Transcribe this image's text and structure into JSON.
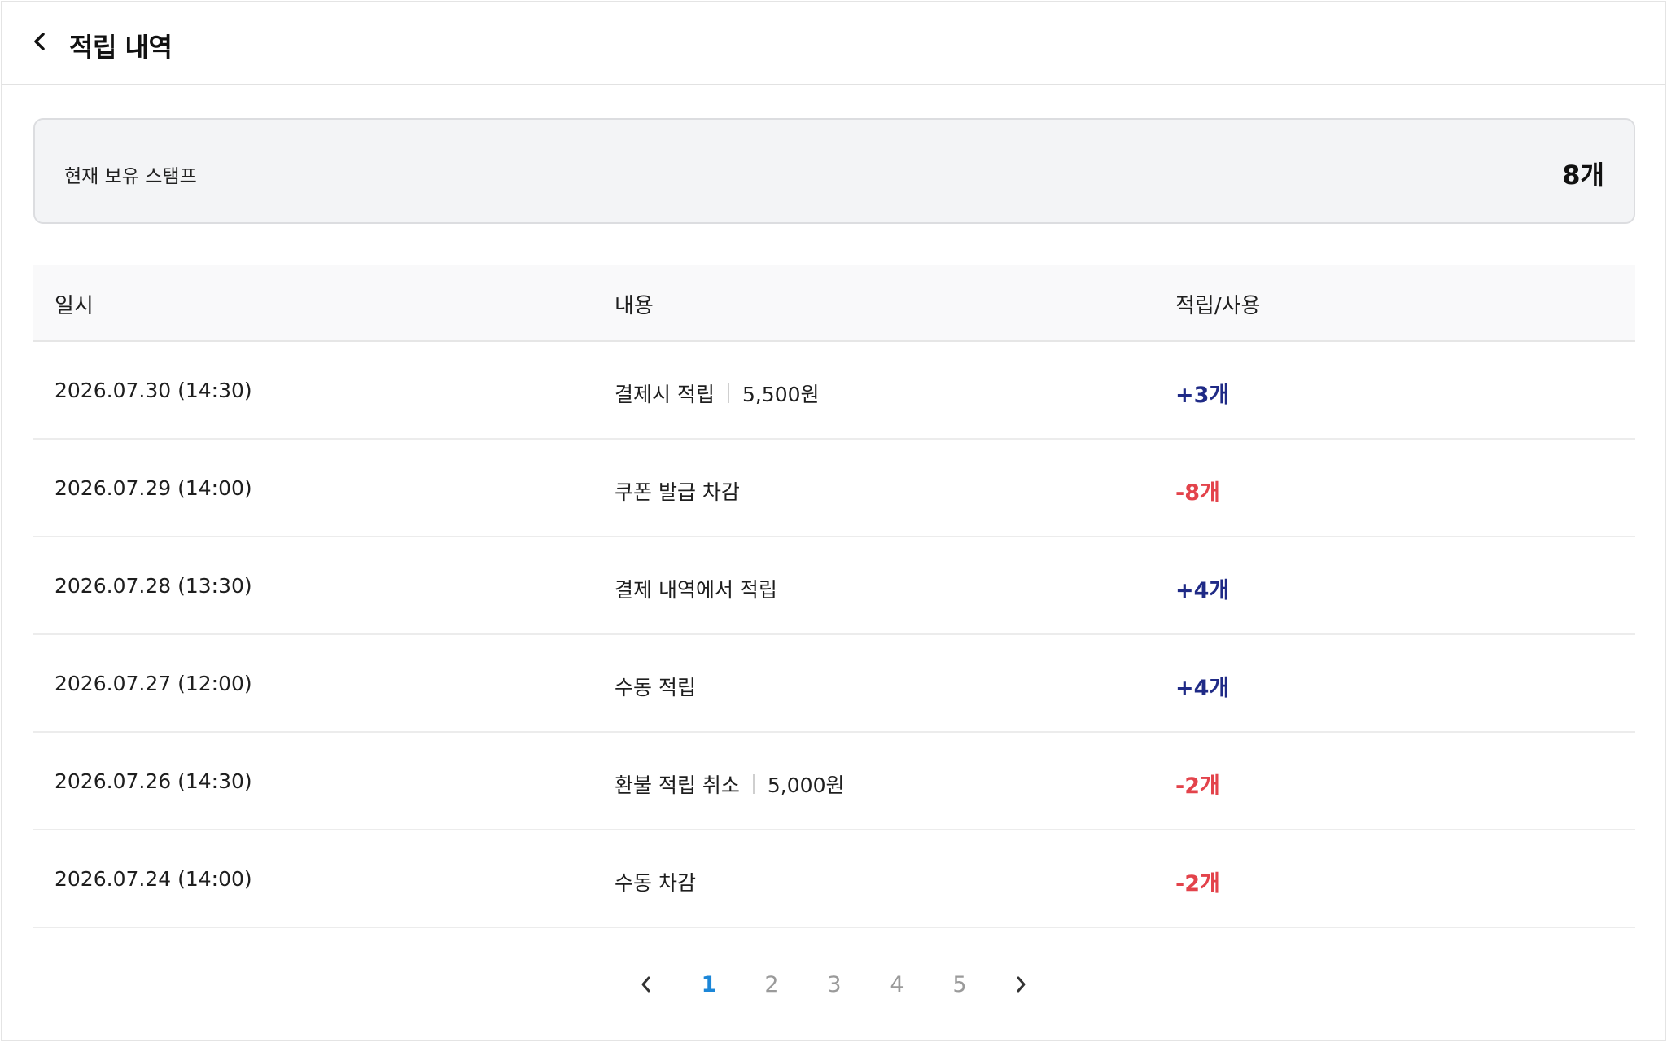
{
  "header": {
    "title": "적립 내역",
    "back_icon": "chevron-left-icon"
  },
  "summary": {
    "label": "현재 보유 스탬프",
    "value": "8개"
  },
  "table": {
    "columns": [
      "일시",
      "내용",
      "적립/사용"
    ],
    "rows": [
      {
        "datetime": "2026.07.30 (14:30)",
        "desc": "결제시 적립",
        "amount_won": "5,500원",
        "change": "+3개",
        "type": "plus"
      },
      {
        "datetime": "2026.07.29 (14:00)",
        "desc": "쿠폰 발급 차감",
        "amount_won": "",
        "change": "-8개",
        "type": "minus"
      },
      {
        "datetime": "2026.07.28 (13:30)",
        "desc": "결제 내역에서 적립",
        "amount_won": "",
        "change": "+4개",
        "type": "plus"
      },
      {
        "datetime": "2026.07.27 (12:00)",
        "desc": "수동 적립",
        "amount_won": "",
        "change": "+4개",
        "type": "plus"
      },
      {
        "datetime": "2026.07.26 (14:30)",
        "desc": "환불 적립 취소",
        "amount_won": "5,000원",
        "change": "-2개",
        "type": "minus"
      },
      {
        "datetime": "2026.07.24 (14:00)",
        "desc": "수동 차감",
        "amount_won": "",
        "change": "-2개",
        "type": "minus"
      }
    ]
  },
  "pagination": {
    "pages": [
      "1",
      "2",
      "3",
      "4",
      "5"
    ],
    "current": "1",
    "prev_icon": "chevron-left-icon",
    "next_icon": "chevron-right-icon"
  },
  "colors": {
    "plus": "#1f2a86",
    "minus": "#e3434b",
    "active_page": "#1c87d8",
    "inactive_page": "#9a9a9a",
    "summary_bg": "#f3f4f6"
  }
}
